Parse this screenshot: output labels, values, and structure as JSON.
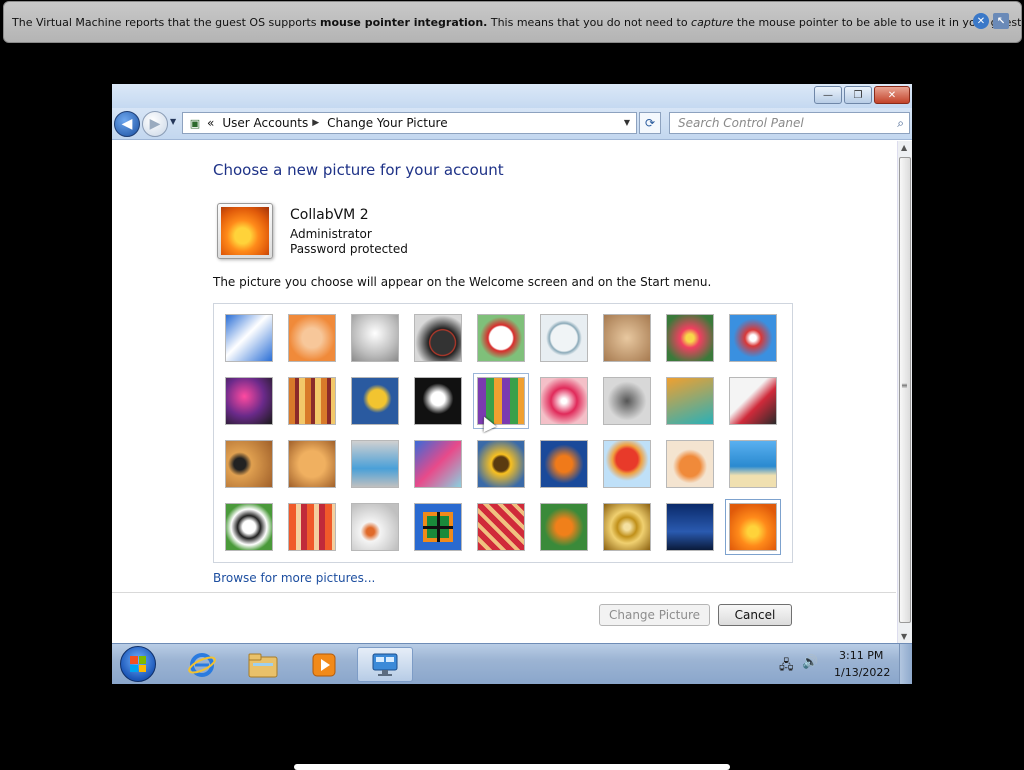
{
  "vm_notification": {
    "part1": "The Virtual Machine reports that the guest OS supports ",
    "bold": "mouse pointer integration.",
    "part2": " This means that you do not need to ",
    "italic": "capture",
    "part3": " the mouse pointer to be able to use it in your guest OS -- all mouse",
    "close_icon": "close-icon",
    "info_icon": "mouse-integration-icon"
  },
  "window": {
    "caption_buttons": {
      "minimize": "—",
      "maximize": "❐",
      "close": "✕"
    }
  },
  "navbar": {
    "back": "◀",
    "forward": "▶",
    "breadcrumb_prefix": "«",
    "breadcrumbs": [
      "User Accounts",
      "Change Your Picture"
    ],
    "search_placeholder": "Search Control Panel"
  },
  "page": {
    "title": "Choose a new picture for your account",
    "account": {
      "name": "CollabVM 2",
      "type": "Administrator",
      "status": "Password protected"
    },
    "description": "The picture you choose will appear on the Welcome screen and on the Start menu.",
    "browse_link": "Browse for more pictures...",
    "change_button": "Change Picture",
    "cancel_button": "Cancel",
    "pictures": [
      "roller-coaster",
      "starfish",
      "robot",
      "turntable",
      "lucky-cat",
      "gyroscope",
      "kitten",
      "pink-flower",
      "wind-wheel",
      "ball",
      "fabric-stripes",
      "leaf",
      "dog",
      "crayons",
      "paper-star",
      "jacks",
      "stairs",
      "origami-crane",
      "guitar",
      "pomeranian",
      "toy-robot",
      "scarf",
      "sunflower",
      "fish",
      "hot-air-balloon",
      "snowman-doll",
      "sailboat",
      "soccer-ball",
      "fabric",
      "marbles",
      "window",
      "pattern",
      "butterfly",
      "spiral",
      "lighthouse",
      "orange-flower"
    ],
    "selected_picture": "orange-flower"
  },
  "taskbar": {
    "apps": [
      "internet-explorer-icon",
      "explorer-icon",
      "media-player-icon",
      "control-panel-icon"
    ],
    "clock_time": "3:11 PM",
    "clock_date": "1/13/2022"
  },
  "colors": {
    "title_blue": "#1e3287",
    "link_blue": "#1e4fa0"
  }
}
